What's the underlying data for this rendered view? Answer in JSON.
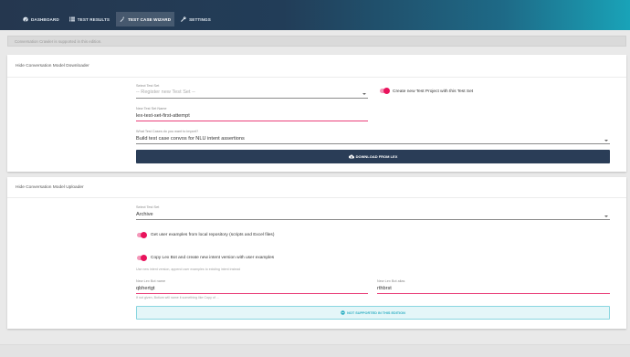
{
  "nav": {
    "items": [
      {
        "label": "DASHBOARD",
        "icon": "dashboard-icon"
      },
      {
        "label": "TEST RESULTS",
        "icon": "list-icon"
      },
      {
        "label": "TEST CASE WIZARD",
        "icon": "wand-icon",
        "active": true
      },
      {
        "label": "SETTINGS",
        "icon": "gear-icon"
      }
    ]
  },
  "notice": {
    "text": "Conversation Crawler is supported in this edition."
  },
  "downloader": {
    "title": "Hide Conversation Model Downloader",
    "test_set_label": "Select Test Set",
    "test_set_value": "-- Register new Test Set --",
    "toggle_label": "Create new Test Project with this Test Set",
    "name_label": "New Test Set Name",
    "name_value": "lex-test-set-first-attempt",
    "import_label": "What Test Cases do you want to import?",
    "import_value": "Build test case convos for NLU intent assertions",
    "button_label": "DOWNLOAD FROM LEX",
    "button_icon": "cloud-download-icon"
  },
  "uploader": {
    "title": "Hide Conversation Model Uploader",
    "test_set_label": "Select Test Set",
    "test_set_value": "Archive",
    "toggle1_label": "Get user examples from local repository (scripts and Excel files)",
    "toggle2_label": "Copy Lex Bot and create new intent version with user examples",
    "toggle2_hint": "Use new intent version, append user examples to existing intent instead",
    "bot_name_label": "New Lex Bot name",
    "bot_name_value": "qbhertgt",
    "bot_name_hint": "If not given, Botium will name it something like Copy of ...",
    "bot_alias_label": "New Lex Bot alias",
    "bot_alias_value": "rthbrst",
    "button_label": "NOT SUPPORTED IN THIS EDITION",
    "button_icon": "block-icon"
  },
  "colors": {
    "accent": "#e9135c",
    "nav_dark": "#25374f",
    "button_dark": "#2a3d57",
    "info": "#2eaec2"
  }
}
